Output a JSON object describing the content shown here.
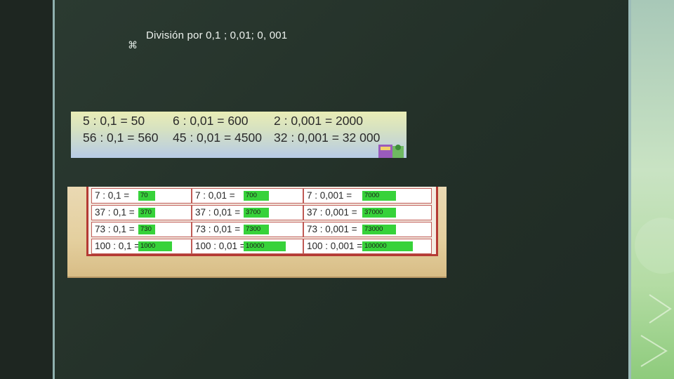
{
  "slide": {
    "icon": "⌘",
    "title": "División por 0,1 ; 0,01; 0, 001"
  },
  "examples": {
    "row1": [
      "5 : 0,1 = 50",
      "6 : 0,01 = 600",
      "2 : 0,001 = 2000"
    ],
    "row2": [
      "56 : 0,1 = 560",
      "45 : 0,01 = 4500",
      "32 : 0,001 = 32 000"
    ]
  },
  "exercises": {
    "rows": [
      [
        {
          "expr": "7 : 0,1 =",
          "answer": "70"
        },
        {
          "expr": "7 : 0,01 =",
          "answer": "700"
        },
        {
          "expr": "7 : 0,001 =",
          "answer": "7000"
        }
      ],
      [
        {
          "expr": "37 : 0,1 =",
          "answer": "370"
        },
        {
          "expr": "37 : 0,01 =",
          "answer": "3700"
        },
        {
          "expr": "37 : 0,001 =",
          "answer": "37000"
        }
      ],
      [
        {
          "expr": "73 : 0,1 =",
          "answer": "730"
        },
        {
          "expr": "73 : 0,01 =",
          "answer": "7300"
        },
        {
          "expr": "73 : 0,001 =",
          "answer": "73000"
        }
      ],
      [
        {
          "expr": "100 : 0,1 =",
          "answer": "1000"
        },
        {
          "expr": "100 : 0,01 =",
          "answer": "10000"
        },
        {
          "expr": "100 : 0,001 =",
          "answer": "100000"
        }
      ]
    ]
  },
  "colors": {
    "board": "#233028",
    "answer_highlight": "#37d23a",
    "frame": "#b43a34"
  }
}
